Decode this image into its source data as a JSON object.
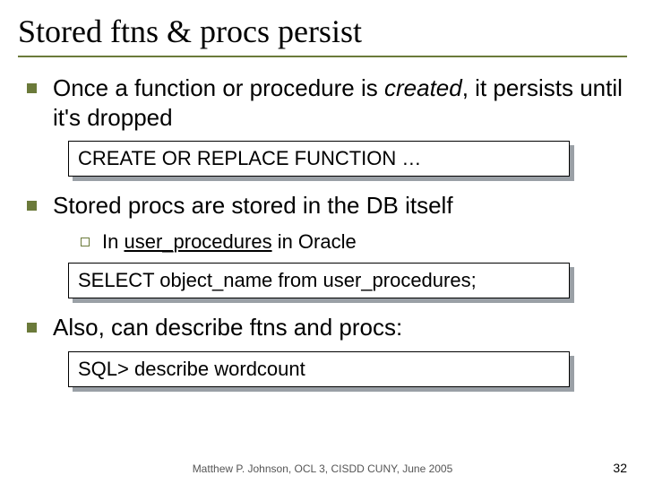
{
  "title": "Stored ftns & procs persist",
  "bullets": [
    {
      "pre": "Once a function or procedure is ",
      "em": "created",
      "post": ", it persists until it's dropped"
    },
    {
      "text": "Stored procs are stored in the DB itself"
    },
    {
      "text": "Also, can describe ftns and procs:"
    }
  ],
  "sub": {
    "pre": "In ",
    "u": "user_procedures",
    "post": " in Oracle"
  },
  "code": [
    "CREATE OR REPLACE FUNCTION …",
    "SELECT object_name from user_procedures;",
    "SQL> describe wordcount"
  ],
  "footer": "Matthew P. Johnson, OCL 3, CISDD CUNY, June 2005",
  "page": "32"
}
